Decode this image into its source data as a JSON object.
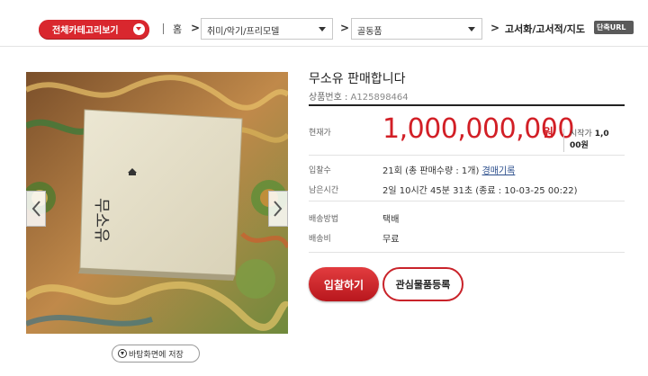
{
  "topbar": {
    "category_button": "전체카테고리보기",
    "home": "홈",
    "crumb1": "취미/악기/프리모델",
    "crumb2": "골동품",
    "crumb3": "고서화/고서적/지도",
    "short_url": "단축URL"
  },
  "photo": {
    "book_title": "무소유",
    "save_label": "바탕화면에 저장"
  },
  "product": {
    "title": "무소유 판매합니다",
    "number_label": "상품번호 :",
    "number_value": "A125898464",
    "price_label": "현재가",
    "price_value": "1,000,000,000",
    "price_unit": "원",
    "start_label": "시작가",
    "start_value_line1": "1,0",
    "start_value_line2": "00원",
    "bids_label": "입찰수",
    "bids_value": "21회 (총 판매수량 : 1개)",
    "bids_link": "경매기록",
    "remaining_label": "남은시간",
    "remaining_value": "2일 10시간 45분 31초 (종료 : 10-03-25 00:22)",
    "shipping_method_label": "배송방법",
    "shipping_method_value": "택배",
    "shipping_fee_label": "배송비",
    "shipping_fee_value": "무료",
    "bid_button": "입찰하기",
    "wishlist_button": "관심물품등록"
  },
  "colors": {
    "accent": "#d21f26",
    "link": "#2b4e8c"
  }
}
